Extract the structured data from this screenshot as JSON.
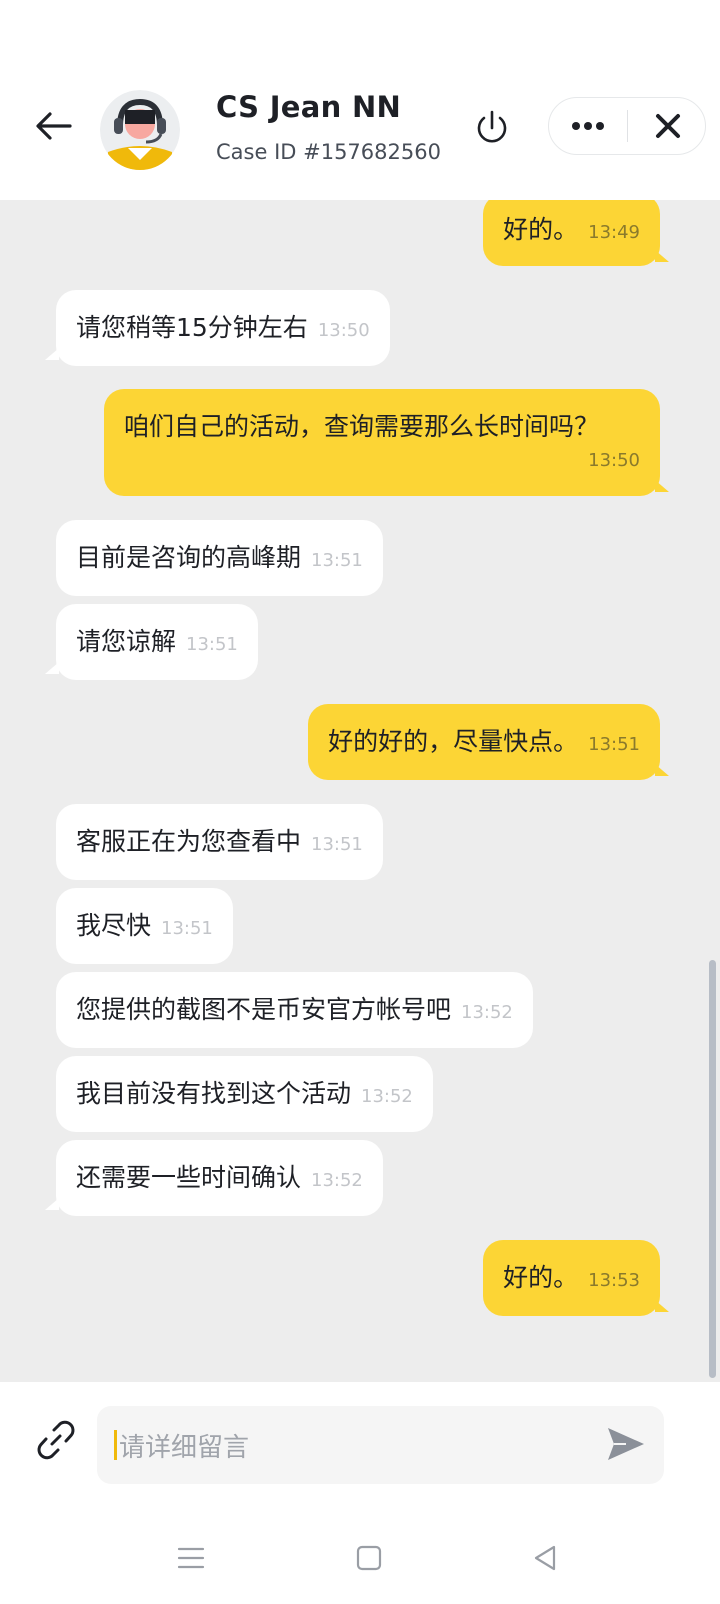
{
  "header": {
    "agent_name": "CS Jean NN",
    "case_id": "Case ID #157682560"
  },
  "messages": [
    {
      "side": "out",
      "text": "好的。",
      "time": "13:49"
    },
    {
      "side": "in",
      "text": "请您稍等15分钟左右",
      "time": "13:50"
    },
    {
      "side": "out",
      "text": "咱们自己的活动，查询需要那么长时间吗？",
      "time": "13:50"
    },
    {
      "side": "in",
      "text": "目前是咨询的高峰期",
      "time": "13:51"
    },
    {
      "side": "in",
      "text": "请您谅解",
      "time": "13:51"
    },
    {
      "side": "out",
      "text": "好的好的，尽量快点。",
      "time": "13:51"
    },
    {
      "side": "in",
      "text": "客服正在为您查看中",
      "time": "13:51"
    },
    {
      "side": "in",
      "text": "我尽快",
      "time": "13:51"
    },
    {
      "side": "in",
      "text": "您提供的截图不是币安官方帐号吧",
      "time": "13:52"
    },
    {
      "side": "in",
      "text": "我目前没有找到这个活动",
      "time": "13:52"
    },
    {
      "side": "in",
      "text": "还需要一些时间确认",
      "time": "13:52"
    },
    {
      "side": "out",
      "text": "好的。",
      "time": "13:53"
    }
  ],
  "composer": {
    "placeholder": "请详细留言"
  },
  "icons": {
    "back": "arrow-left-icon",
    "power": "power-icon",
    "more": "more-horizontal-icon",
    "close": "close-icon",
    "attach": "link-icon",
    "send": "send-icon"
  },
  "colors": {
    "accent": "#fcd535",
    "chat_background": "#ededed",
    "incoming_bubble": "#ffffff"
  }
}
